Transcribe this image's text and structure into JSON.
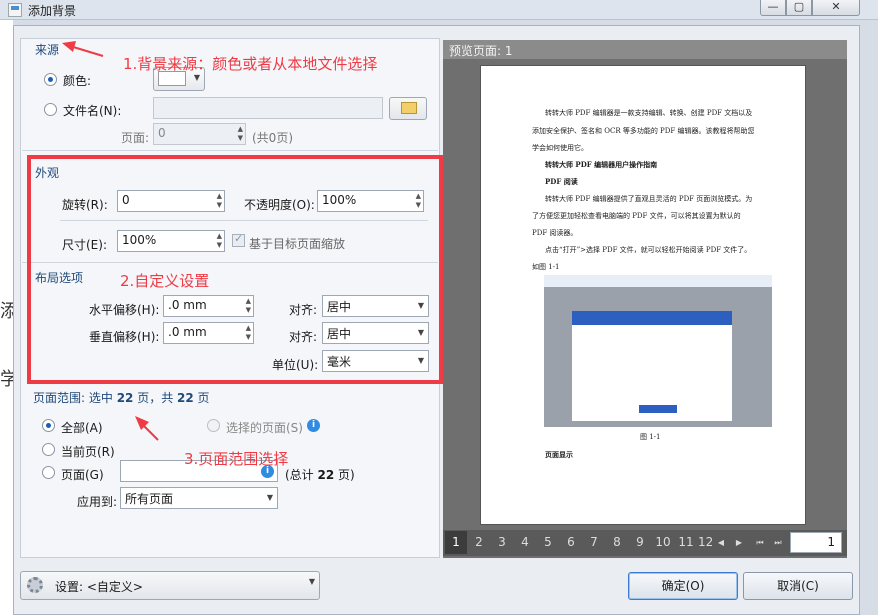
{
  "window": {
    "title": "添加背景",
    "min_glyph": "—",
    "max_glyph": "▢",
    "close_glyph": "✕"
  },
  "outside_fragments": [
    "添",
    "学"
  ],
  "source": {
    "header": "来源",
    "color_label": "颜色:",
    "file_label": "文件名(N):",
    "page_label": "页面:",
    "page_value": "0",
    "page_total": "(共0页)",
    "file_value": ""
  },
  "appearance": {
    "header": "外观",
    "rotation_label": "旋转(R):",
    "rotation_value": "0",
    "opacity_label": "不透明度(O):",
    "opacity_value": "100%",
    "size_label": "尺寸(E):",
    "size_value": "100%",
    "scale_label": "基于目标页面缩放"
  },
  "layout": {
    "header": "布局选项",
    "hoffset_label": "水平偏移(H):",
    "hoffset_value": ".0 mm",
    "voffset_label": "垂直偏移(H):",
    "voffset_value": ".0 mm",
    "align1_label": "对齐:",
    "align1_value": "居中",
    "align2_label": "对齐:",
    "align2_value": "居中",
    "unit_label": "单位(U):",
    "unit_value": "毫米"
  },
  "range": {
    "header_prefix": "页面范围: 选中 ",
    "selected": "22",
    "mid": " 页，共 ",
    "total": "22",
    "suffix": " 页",
    "all_label": "全部(A)",
    "selected_pages_label": "选择的页面(S)",
    "current_label": "当前页(R)",
    "pages_label": "页面(G)",
    "pages_value": "",
    "pages_total_prefix": "(总计 ",
    "pages_total_suffix": " 页)",
    "apply_label": "应用到:",
    "apply_value": "所有页面"
  },
  "annotations": {
    "n1": "1.背景来源：颜色或者从本地文件选择",
    "n2": "2.自定义设置",
    "n3": "3.页面范围选择"
  },
  "preview": {
    "header": "预览页面: 1",
    "lines": [
      "转转大师 PDF 编辑器是一款支持编辑、转换、创建 PDF 文档以及",
      "添加安全保护、签名和 OCR 等多功能的 PDF 编辑器。该教程将帮助您",
      "学会如何使用它。",
      "转转大师 PDF 编辑器用户操作指南",
      "PDF 阅读",
      "转转大师 PDF 编辑器提供了直观且灵活的 PDF 页面浏览模式。为",
      "了方便您更加轻松查看电脑端的 PDF 文件，可以将其设置为默认的",
      "PDF 阅读器。",
      "点击“打开”>选择 PDF 文件，就可以轻松开始阅读 PDF 文件了。",
      "如图 1-1",
      "图 1-1",
      "页面显示"
    ]
  },
  "pager": {
    "pages": [
      "1",
      "2",
      "3",
      "4",
      "5",
      "6",
      "7",
      "8",
      "9",
      "10",
      "11",
      "12"
    ],
    "page_input": "1",
    "nav": [
      "◀",
      "▶",
      "⏮",
      "⏭"
    ]
  },
  "footer": {
    "settings_label": "设置: <自定义>",
    "ok": "确定(O)",
    "cancel": "取消(C)"
  },
  "colors": {
    "accent_red": "#ef3b45",
    "header_blue": "#1f4a7a",
    "info_blue": "#2f8ce0"
  }
}
